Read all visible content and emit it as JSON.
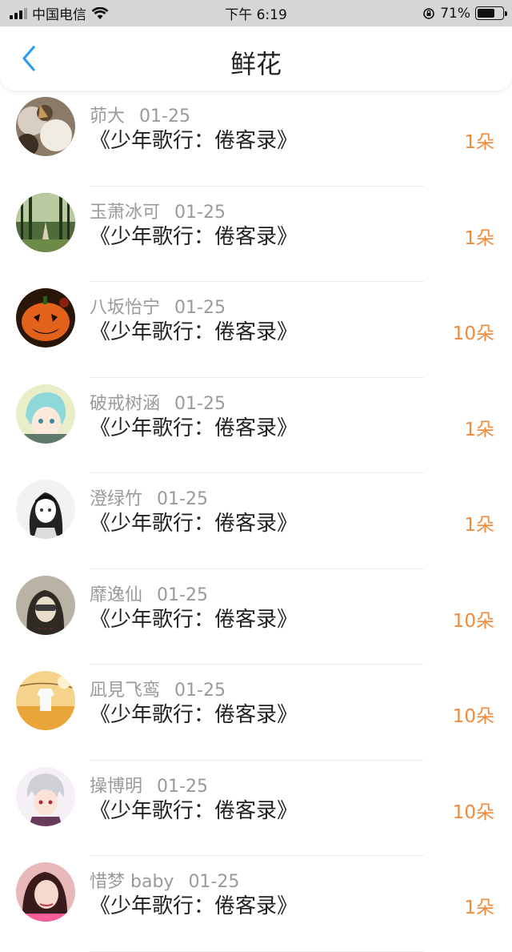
{
  "status_bar": {
    "carrier": "中国电信",
    "time": "下午 6:19",
    "battery": "71%",
    "battery_level": 0.71,
    "icons": [
      "signal-icon",
      "wifi-icon",
      "orientation-lock-icon",
      "battery-icon"
    ]
  },
  "header": {
    "title": "鲜花",
    "back_icon": "chevron-left-icon",
    "accent_color": "#2d9bf0"
  },
  "count_color": "#f08a3c",
  "items": [
    {
      "user": "茆大",
      "date": "01-25",
      "book": "《少年歌行：倦客录》",
      "count": "1朵"
    },
    {
      "user": "玉萧冰可",
      "date": "01-25",
      "book": "《少年歌行：倦客录》",
      "count": "1朵"
    },
    {
      "user": "八坂怡宁",
      "date": "01-25",
      "book": "《少年歌行：倦客录》",
      "count": "10朵"
    },
    {
      "user": "破戒树涵",
      "date": "01-25",
      "book": "《少年歌行：倦客录》",
      "count": "1朵"
    },
    {
      "user": "澄绿竹",
      "date": "01-25",
      "book": "《少年歌行：倦客录》",
      "count": "1朵"
    },
    {
      "user": "靡逸仙",
      "date": "01-25",
      "book": "《少年歌行：倦客录》",
      "count": "10朵"
    },
    {
      "user": "凪見飞鸾",
      "date": "01-25",
      "book": "《少年歌行：倦客录》",
      "count": "10朵"
    },
    {
      "user": "操博明",
      "date": "01-25",
      "book": "《少年歌行：倦客录》",
      "count": "10朵"
    },
    {
      "user": "惜梦 baby",
      "date": "01-25",
      "book": "《少年歌行：倦客录》",
      "count": "1朵"
    }
  ]
}
